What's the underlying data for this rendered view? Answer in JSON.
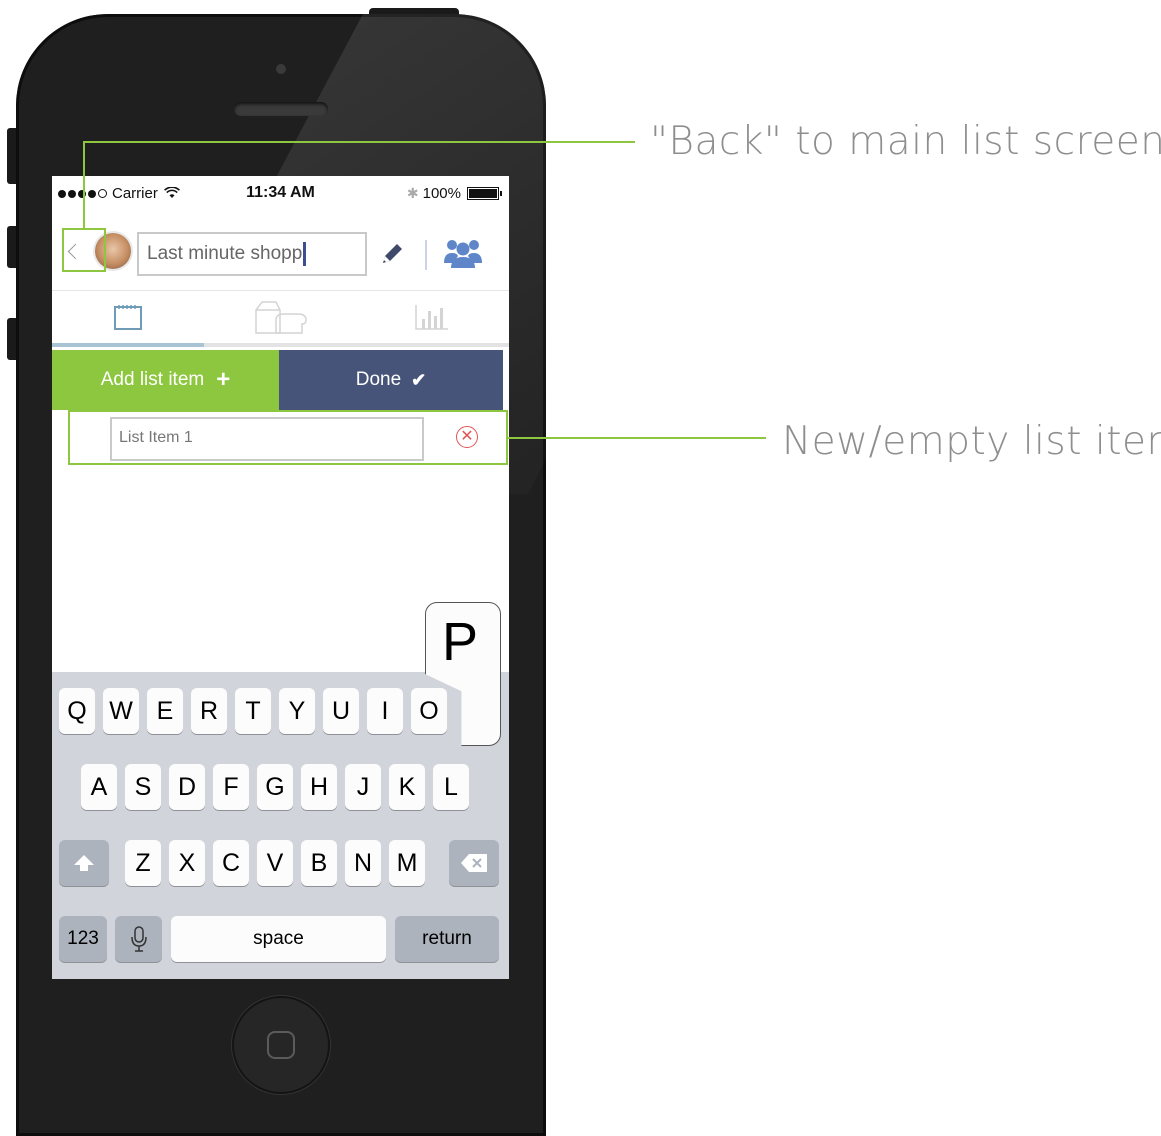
{
  "status_bar": {
    "carrier": "Carrier",
    "time": "11:34 AM",
    "battery": "100%"
  },
  "header": {
    "list_title_value": "Last minute shopp"
  },
  "tabs": [
    {
      "icon": "notepad-icon",
      "active": true
    },
    {
      "icon": "grocery-icon",
      "active": false
    },
    {
      "icon": "bar-chart-icon",
      "active": false
    }
  ],
  "actions": {
    "add_label": "Add list item",
    "done_label": "Done"
  },
  "list_item": {
    "value": "List Item 1"
  },
  "keyboard": {
    "row1": [
      "Q",
      "W",
      "E",
      "R",
      "T",
      "Y",
      "U",
      "I",
      "O"
    ],
    "popup": "P",
    "row2": [
      "A",
      "S",
      "D",
      "F",
      "G",
      "H",
      "J",
      "K",
      "L"
    ],
    "row3": [
      "Z",
      "X",
      "C",
      "V",
      "B",
      "N",
      "M"
    ],
    "numbers_label": "123",
    "space_label": "space",
    "return_label": "return"
  },
  "annotations": {
    "back": "\"Back\" to main list screen",
    "new_item": "New/empty list item"
  },
  "colors": {
    "accent_green": "#8dc63f",
    "done_navy": "#46547a",
    "annotation_text": "#8e8e8e"
  }
}
